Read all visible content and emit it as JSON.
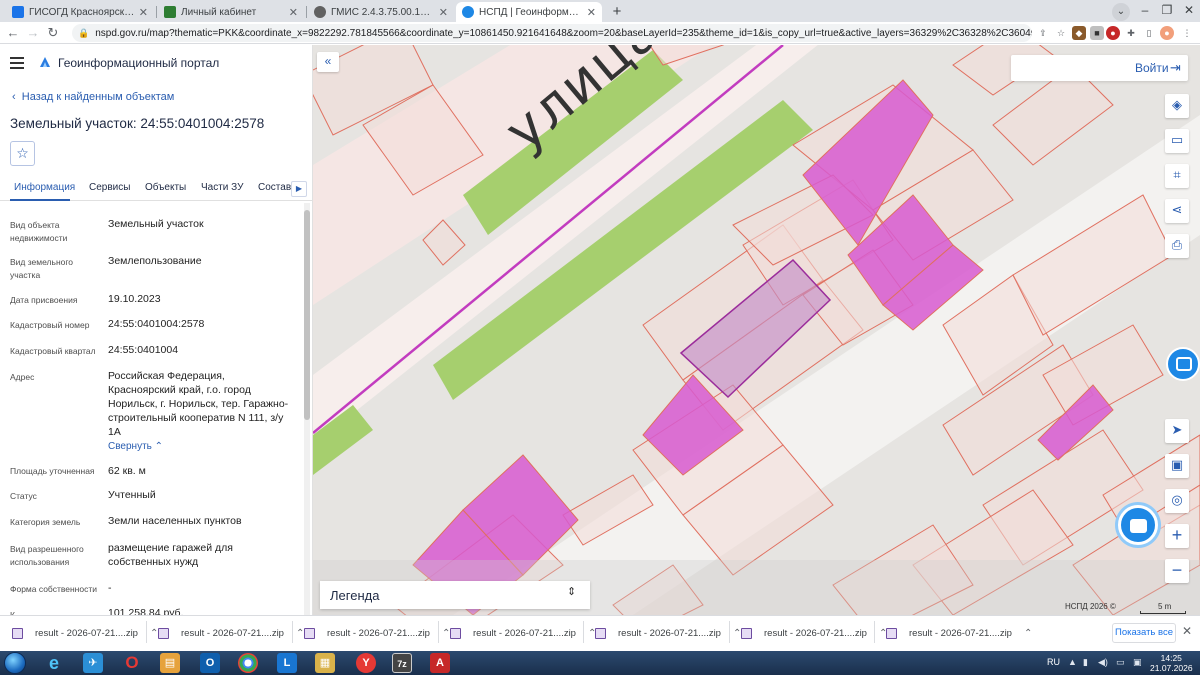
{
  "browser": {
    "tabs": [
      {
        "title": "ГИСОГД Красноярского края",
        "color": "#1a73e8"
      },
      {
        "title": "Личный кабинет",
        "color": "#2e7d32"
      },
      {
        "title": "ГМИС 2.4.3.75.00.10.34",
        "color": "#616161"
      },
      {
        "title": "НСПД | Геоинформационный п",
        "color": "#1e88e5"
      }
    ],
    "new_tab": "+",
    "tab_close": "✕",
    "window_controls": [
      "–",
      "❐",
      "✕"
    ],
    "url": "nspd.gov.ru/map?thematic=PKK&coordinate_x=9822292.781845566&coordinate_y=10861450.921641648&zoom=20&baseLayerId=235&theme_id=1&is_copy_url=true&active_layers=36329%2C36328%2C36049%2C36048&selectedCard=153...",
    "nav_icons": [
      "back-icon",
      "forward-icon",
      "reload-icon",
      "lock-icon"
    ]
  },
  "panel": {
    "portal_title": "Геоинформационный портал",
    "back_link": "Назад к найденным объектам",
    "object_title": "Земельный участок: 24:55:0401004:2578",
    "tabs": [
      "Информация",
      "Сервисы",
      "Объекты",
      "Части ЗУ",
      "Состав"
    ],
    "fields": [
      {
        "label": "Вид объекта недвижимости",
        "value": "Земельный участок"
      },
      {
        "label": "Вид земельного участка",
        "value": "Землепользование"
      },
      {
        "label": "Дата присвоения",
        "value": "19.10.2023"
      },
      {
        "label": "Кадастровый номер",
        "value": "24:55:0401004:2578"
      },
      {
        "label": "Кадастровый квартал",
        "value": "24:55:0401004"
      },
      {
        "label": "Адрес",
        "value": "Российская Федерация, Красноярский край, г.о. город Норильск, г. Норильск, тер. Гаражно-строительный кооператив N 111, з/у 1А"
      },
      {
        "label": "Площадь уточненная",
        "value": "62 кв. м"
      },
      {
        "label": "Статус",
        "value": "Учтенный"
      },
      {
        "label": "Категория земель",
        "value": "Земли населенных пунктов"
      },
      {
        "label": "Вид разрешенного использования",
        "value": "размещение гаражей для собственных нужд"
      },
      {
        "label": "Форма собственности",
        "value": "-"
      },
      {
        "label": "К",
        "value": "101 258,84 руб."
      }
    ],
    "collapse_link": "Свернуть"
  },
  "map": {
    "street_label": "улица Ст",
    "login": "Войти",
    "legend": "Легенда",
    "attribution": "НСПД 2026 ©",
    "scale": "5 m",
    "tools": [
      "layers-icon",
      "ruler-icon",
      "select-area-icon",
      "share-icon",
      "print-icon"
    ],
    "side_tools": [
      "locate-icon",
      "basemap-icon",
      "geolocation-icon"
    ],
    "zoom_in": "+",
    "zoom_out": "−",
    "colors": {
      "selected_parcel": "#b04bb8",
      "parcel_fill": "#d75ad0",
      "parcel_border": "#e07060",
      "road": "#f4dcdc",
      "green": "#a6cf6e"
    }
  },
  "downloads": {
    "items": [
      "result - 2026-07-21....zip",
      "result - 2026-07-21....zip",
      "result - 2026-07-21....zip",
      "result - 2026-07-21....zip",
      "result - 2026-07-21....zip",
      "result - 2026-07-21....zip",
      "result - 2026-07-21....zip"
    ],
    "show_all": "Показать все",
    "close": "✕"
  },
  "taskbar": {
    "apps": [
      {
        "name": "ie",
        "label": "e",
        "color": "#1e88e5"
      },
      {
        "name": "messenger",
        "label": "✈",
        "color": "#2b8fd6"
      },
      {
        "name": "opera",
        "label": "O",
        "color": "#d32f2f"
      },
      {
        "name": "explorer-files",
        "label": "▤",
        "color": "#e6a23c"
      },
      {
        "name": "outlook",
        "label": "O",
        "color": "#0f5fad"
      },
      {
        "name": "chrome",
        "label": "●",
        "color": "#34a853"
      },
      {
        "name": "lync",
        "label": "L",
        "color": "#1976d2"
      },
      {
        "name": "folder",
        "label": "▦",
        "color": "#d9b24a"
      },
      {
        "name": "yandex",
        "label": "Y",
        "color": "#e53935"
      },
      {
        "name": "7zip",
        "label": "7z",
        "color": "#444"
      },
      {
        "name": "acrobat",
        "label": "A",
        "color": "#c62828"
      }
    ],
    "language": "RU",
    "time": "14:25",
    "date": "21.07.2026"
  }
}
